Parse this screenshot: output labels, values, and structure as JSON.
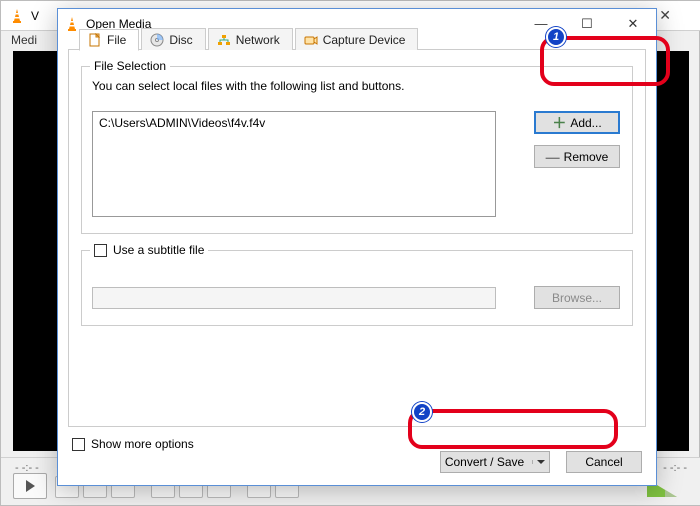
{
  "background": {
    "title_letter": "V",
    "menu_item": "Medi",
    "time_left": "- -:- -",
    "time_right": "- -:- -"
  },
  "dialog": {
    "title": "Open Media",
    "tabs": {
      "file": "File",
      "disc": "Disc",
      "network": "Network",
      "capture": "Capture Device"
    },
    "file_selection": {
      "legend": "File Selection",
      "hint": "You can select local files with the following list and buttons.",
      "entries": [
        "C:\\Users\\ADMIN\\Videos\\f4v.f4v"
      ],
      "add_label": "Add...",
      "remove_label": "Remove"
    },
    "subtitle": {
      "checkbox_label": "Use a subtitle file",
      "browse_label": "Browse..."
    },
    "footer": {
      "show_more_label": "Show more options",
      "convert_label": "Convert / Save",
      "cancel_label": "Cancel"
    }
  },
  "annotations": {
    "badge1": "1",
    "badge2": "2"
  }
}
